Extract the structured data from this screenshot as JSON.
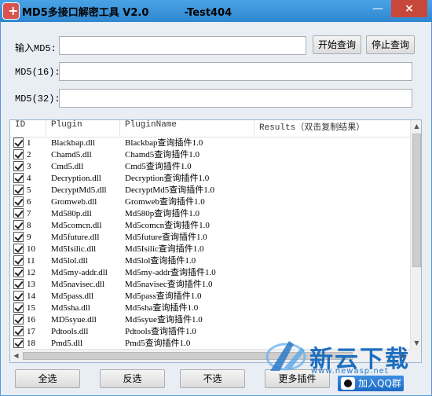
{
  "title": {
    "app": "MD5多接口解密工具 V2.0",
    "build": "-Test404",
    "minimize": "—",
    "close": "×"
  },
  "form": {
    "input_label": "输入MD5:",
    "input_value": "",
    "md5_16_label": "MD5(16):",
    "md5_16_value": "",
    "md5_32_label": "MD5(32):",
    "md5_32_value": "",
    "start_button": "开始查询",
    "stop_button": "停止查询"
  },
  "table": {
    "columns": [
      "ID",
      "Plugin",
      "PluginName",
      "Results（双击复制结果）"
    ],
    "rows": [
      {
        "id": "1",
        "checked": true,
        "plugin": "Blackbap.dll",
        "name": "Blackbap查询插件1.0"
      },
      {
        "id": "2",
        "checked": true,
        "plugin": "Chamd5.dll",
        "name": "Chamd5查询插件1.0"
      },
      {
        "id": "3",
        "checked": true,
        "plugin": "Cmd5.dll",
        "name": "Cmd5查询插件1.0"
      },
      {
        "id": "4",
        "checked": true,
        "plugin": "Decryption.dll",
        "name": "Decryption查询插件1.0"
      },
      {
        "id": "5",
        "checked": true,
        "plugin": "DecryptMd5.dll",
        "name": "DecryptMd5查询插件1.0"
      },
      {
        "id": "6",
        "checked": true,
        "plugin": "Gromweb.dll",
        "name": "Gromweb查询插件1.0"
      },
      {
        "id": "7",
        "checked": true,
        "plugin": "Md580p.dll",
        "name": "Md580p查询插件1.0"
      },
      {
        "id": "8",
        "checked": true,
        "plugin": "Md5comcn.dll",
        "name": "Md5comcn查询插件1.0"
      },
      {
        "id": "9",
        "checked": true,
        "plugin": "Md5future.dll",
        "name": "Md5future查询插件1.0"
      },
      {
        "id": "10",
        "checked": true,
        "plugin": "Md5Isilic.dll",
        "name": "Md5Isilic查询插件1.0"
      },
      {
        "id": "11",
        "checked": true,
        "plugin": "Md5lol.dll",
        "name": "Md5lol查询插件1.0"
      },
      {
        "id": "12",
        "checked": true,
        "plugin": "Md5my-addr.dll",
        "name": "Md5my-addr查询插件1.0"
      },
      {
        "id": "13",
        "checked": true,
        "plugin": "Md5navisec.dll",
        "name": "Md5navisec查询插件1.0"
      },
      {
        "id": "14",
        "checked": true,
        "plugin": "Md5pass.dll",
        "name": "Md5pass查询插件1.0"
      },
      {
        "id": "15",
        "checked": true,
        "plugin": "Md5sha.dll",
        "name": "Md5sha查询插件1.0"
      },
      {
        "id": "16",
        "checked": true,
        "plugin": "MD5syue.dll",
        "name": "Md5syue查询插件1.0"
      },
      {
        "id": "17",
        "checked": true,
        "plugin": "Pdtools.dll",
        "name": "Pdtools查询插件1.0"
      },
      {
        "id": "18",
        "checked": true,
        "plugin": "Pmd5.dll",
        "name": "Pmd5查询插件1.0"
      }
    ]
  },
  "bottom": {
    "select_all": "全选",
    "invert": "反选",
    "select_none": "不选",
    "more_plugins": "更多插件",
    "join_qq": "加入QQ群"
  },
  "watermark": {
    "brand": "新云下载",
    "url": "www.newasp.net"
  },
  "colors": {
    "titlebar": "#2f87cf",
    "window_bg": "#e9eef5",
    "close": "#c7473b",
    "qq_button": "#1c6ac4",
    "watermark": "#1e6fbf"
  }
}
